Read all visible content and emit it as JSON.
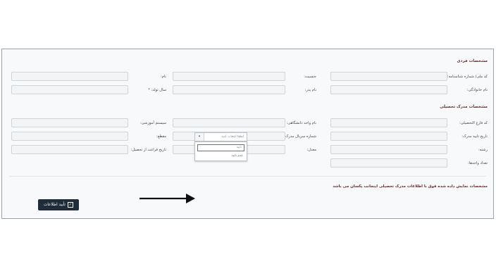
{
  "personal": {
    "title": "مشخصات فردی",
    "national_code_label": "کد ملی/ شماره شناسنامه:",
    "gender_label": "جنسیت:",
    "first_name_label": "نام:",
    "last_name_label": "نام خانوادگی:",
    "father_name_label": "نام پدر:",
    "birth_year_label": "سال تولد: *"
  },
  "degree": {
    "title": "مشخصات مدرک تحصیلی",
    "graduate_code_label": "کد فارغ التحصیلی:",
    "university_unit_label": "نام واحد دانشگاهی:",
    "education_system_label": "سیستم آموزشی:",
    "verification_date_label": "تاریخ تایید مدرک:",
    "serial_label": "شماره سریال مدرک:",
    "level_label": "مقطع:",
    "major_label": "رشته:",
    "gpa_label": "معدل:",
    "graduation_date_label": "تاریخ فراغت از تحصیل:",
    "units_label": "تعداد واحدها:"
  },
  "confirm": {
    "question": "مشخصات نمایش داده شده فوق با اطلاعات مدرک تحصیلی اینجانب یکسان می باشد",
    "select_placeholder": "لطفا انتخاب کنید",
    "option_confirm": "تایید",
    "option_reject": "عدم تایید",
    "submit_label": "تأیید اطلاعات"
  },
  "icons": {
    "check": "checkbox-icon",
    "dropdown": "chevron-down-icon",
    "arrow": "arrow-right-icon"
  }
}
